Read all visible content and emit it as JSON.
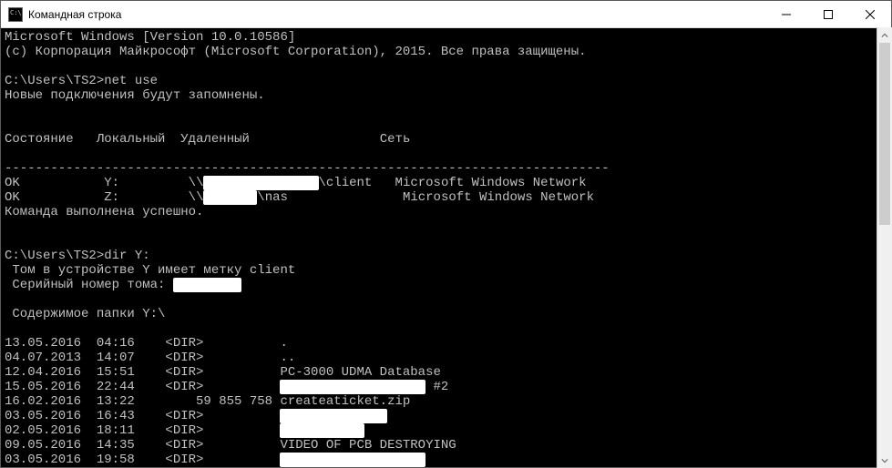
{
  "window": {
    "title": "Командная строка"
  },
  "lines": {
    "ver": "Microsoft Windows [Version 10.0.10586]",
    "copy": "(с) Корпорация Майкрософт (Microsoft Corporation), 2015. Все права защищены.",
    "prompt1": "C:\\Users\\TS2>",
    "cmd1": "net use",
    "netnew": "Новые подключения будут запомнены.",
    "hdr_status": "Состояние",
    "hdr_local": "Локальный",
    "hdr_remote": "Удаленный",
    "hdr_net": "Сеть",
    "sep": "-------------------------------------------------------------------------------",
    "r1_status": "OK",
    "r1_local": "Y:",
    "r1_rprefix": "\\\\",
    "r1_rsuffix": "\\client",
    "r1_net": "Microsoft Windows Network",
    "r2_status": "OK",
    "r2_local": "Z:",
    "r2_rprefix": "\\\\",
    "r2_rsuffix": "\\nas",
    "r2_net": "Microsoft Windows Network",
    "cmddone": "Команда выполнена успешно.",
    "prompt2": "C:\\Users\\TS2>",
    "cmd2": "dir Y:",
    "vol": " Том в устройстве Y имеет метку client",
    "serial_pre": " Серийный номер тома: ",
    "contents": " Содержимое папки Y:\\",
    "d1": "13.05.2016  04:16    <DIR>          .",
    "d2": "04.07.2013  14:07    <DIR>          ..",
    "d3": "12.04.2016  15:51    <DIR>          PC-3000 UDMA Database",
    "d4a": "15.05.2016  22:44    <DIR>          ",
    "d4b": " #2",
    "d5": "16.02.2016  13:22        59 855 758 createaticket.zip",
    "d6a": "03.05.2016  16:43    <DIR>          ",
    "d7a": "02.05.2016  18:11    <DIR>          ",
    "d8": "09.05.2016  14:35    <DIR>          VIDEO OF PCB DESTROYING",
    "d9a": "03.05.2016  19:58    <DIR>          "
  },
  "redactions": {
    "host1": "xxx.xxx.xxx.xxx",
    "host2": "xxxxxxx",
    "serial": "XXXX-XXXX",
    "name4": "xxxxxxxxxxxxxxxxxxx",
    "name6": "xxxxxxxxxxxxxx",
    "name7": "xxxxxxxxxxx",
    "name9": "xxxxxxxxxxxxxxxxxxx"
  }
}
